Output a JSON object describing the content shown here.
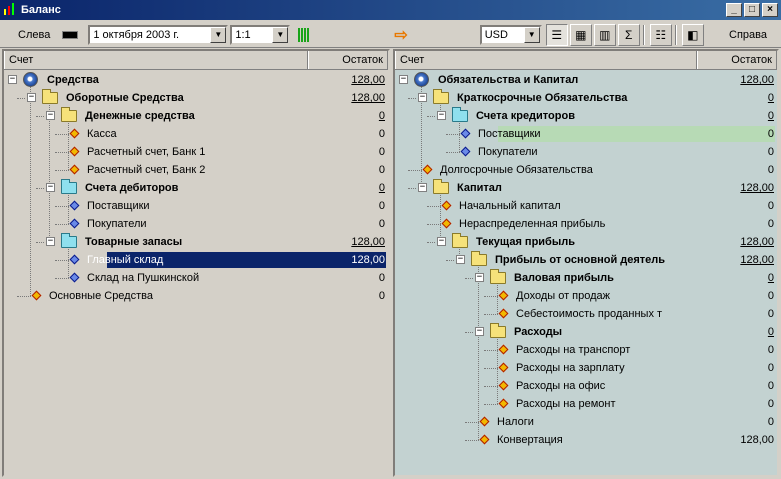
{
  "window": {
    "title": "Баланс"
  },
  "toolbar": {
    "left_label": "Слева",
    "right_label": "Справа",
    "date": "1  октября  2003 г.",
    "scale": "1:1",
    "currency": "USD"
  },
  "left": {
    "col_account": "Счет",
    "col_balance": "Остаток",
    "rows": [
      {
        "label": "Средства",
        "value": "128,00"
      },
      {
        "label": "Оборотные Средства",
        "value": "128,00"
      },
      {
        "label": "Денежные средства",
        "value": "0"
      },
      {
        "label": "Касса",
        "value": "0"
      },
      {
        "label": "Расчетный счет, Банк 1",
        "value": "0"
      },
      {
        "label": "Расчетный счет, Банк 2",
        "value": "0"
      },
      {
        "label": "Счета дебиторов",
        "value": "0"
      },
      {
        "label": "Поставщики",
        "value": "0"
      },
      {
        "label": "Покупатели",
        "value": "0"
      },
      {
        "label": "Товарные запасы",
        "value": "128,00"
      },
      {
        "label": "Главный склад",
        "value": "128,00"
      },
      {
        "label": "Склад на Пушкинской",
        "value": "0"
      },
      {
        "label": "Основные Средства",
        "value": "0"
      }
    ]
  },
  "right": {
    "col_account": "Счет",
    "col_balance": "Остаток",
    "rows": [
      {
        "label": "Обязательства и Капитал",
        "value": "128,00"
      },
      {
        "label": "Краткосрочные Обязательства",
        "value": "0"
      },
      {
        "label": "Счета кредиторов",
        "value": "0"
      },
      {
        "label": "Поставщики",
        "value": "0"
      },
      {
        "label": "Покупатели",
        "value": "0"
      },
      {
        "label": "Долгосрочные Обязательства",
        "value": "0"
      },
      {
        "label": "Капитал",
        "value": "128,00"
      },
      {
        "label": "Начальный капитал",
        "value": "0"
      },
      {
        "label": "Нераспределенная прибыль",
        "value": "0"
      },
      {
        "label": "Текущая прибыль",
        "value": "128,00"
      },
      {
        "label": "Прибыль от основной деятель",
        "value": "128,00"
      },
      {
        "label": "Валовая прибыль",
        "value": "0"
      },
      {
        "label": "Доходы от продаж",
        "value": "0"
      },
      {
        "label": "Себестоимость проданных т",
        "value": "0"
      },
      {
        "label": "Расходы",
        "value": "0"
      },
      {
        "label": "Расходы на транспорт",
        "value": "0"
      },
      {
        "label": "Расходы на зарплату",
        "value": "0"
      },
      {
        "label": "Расходы на офис",
        "value": "0"
      },
      {
        "label": "Расходы на ремонт",
        "value": "0"
      },
      {
        "label": "Налоги",
        "value": "0"
      },
      {
        "label": "Конвертация",
        "value": "128,00"
      }
    ]
  }
}
